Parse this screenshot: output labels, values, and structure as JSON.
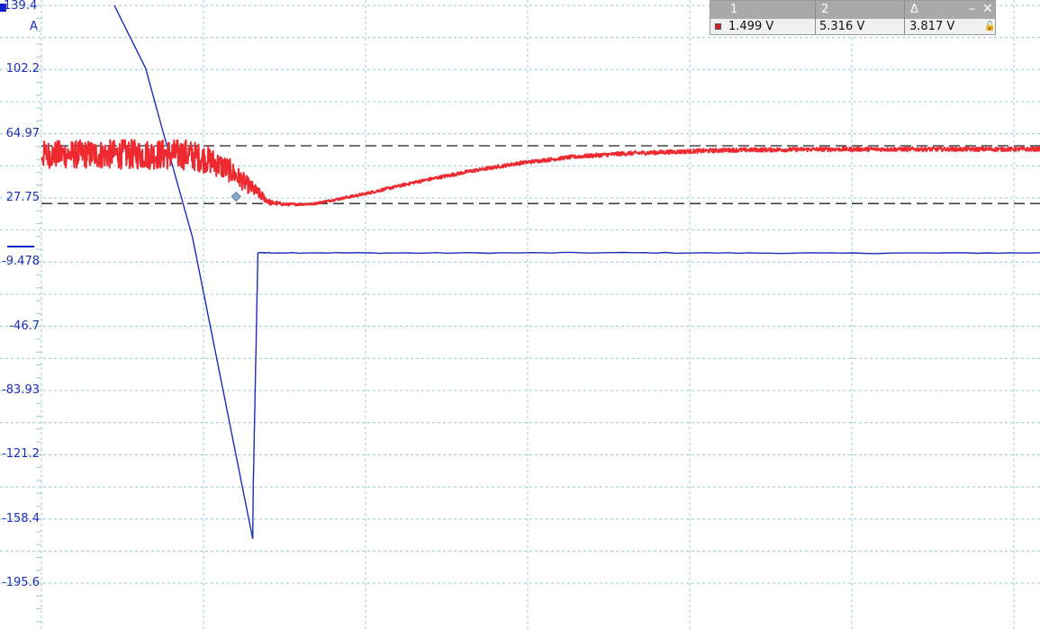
{
  "channel": {
    "unit": "A",
    "top_value": "139.4",
    "color": "#1122cc"
  },
  "y_ticks": [
    "139.4",
    "102.2",
    "64.97",
    "27.75",
    "-9.478",
    "-46.7",
    "-83.93",
    "-121.2",
    "-158.4",
    "-195.6"
  ],
  "cursor_panel": {
    "col1_header": "1",
    "col2_header": "2",
    "col3_header": "Δ",
    "col1_value": "1.499 V",
    "col2_value": "5.316 V",
    "col3_value": "3.817 V",
    "minimize_icon": "minimize-icon",
    "close_icon": "close-icon",
    "lock_icon": "lock-icon"
  },
  "chart_data": {
    "type": "line",
    "y_axis": {
      "ticks": [
        139.4,
        102.2,
        64.97,
        27.75,
        -9.478,
        -46.7,
        -83.93,
        -121.2,
        -158.4,
        -195.6
      ],
      "unit": "A"
    },
    "grid": true,
    "series": [
      {
        "color": "#1a2fb8",
        "x": [
          0.11,
          0.14,
          0.155,
          0.185,
          0.2,
          0.243,
          0.2435,
          0.248,
          0.26,
          0.4,
          0.6,
          0.8,
          1.0
        ],
        "y": [
          139.4,
          103.0,
          70.0,
          5.0,
          -40.0,
          -170.0,
          -140.0,
          -4.0,
          -4.0,
          -4.2,
          -4.0,
          -4.3,
          -4.1
        ],
        "noisy": false
      },
      {
        "color": "#ee2a30",
        "x": [
          0.04,
          0.18,
          0.2,
          0.22,
          0.245,
          0.26,
          0.275,
          0.3,
          0.35,
          0.4,
          0.45,
          0.5,
          0.55,
          0.6,
          0.7,
          0.8,
          0.9,
          1.0
        ],
        "y": [
          53.0,
          53.0,
          50.0,
          44.0,
          32.0,
          25.0,
          24.0,
          24.2,
          30.0,
          37.0,
          43.0,
          48.0,
          51.5,
          53.5,
          55.5,
          56.0,
          56.0,
          56.0
        ],
        "noise": [
          8,
          9,
          8,
          7,
          4,
          1.5,
          0.8,
          0.6,
          0.8,
          0.9,
          1.0,
          1.0,
          1.1,
          1.2,
          1.2,
          1.2,
          1.2,
          1.2
        ]
      }
    ],
    "cursors": {
      "cursor1_value": 24.5,
      "cursor2_value": 58.0
    }
  }
}
